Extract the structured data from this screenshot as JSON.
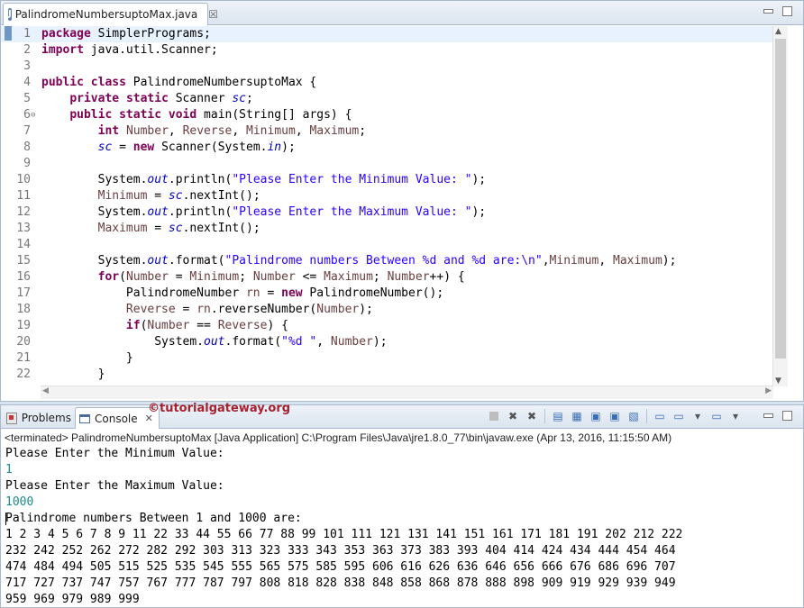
{
  "editor": {
    "tab_label": "PalindromeNumbersuptoMax.java",
    "close_glyph": "☒",
    "lines": [
      {
        "num": "1",
        "tokens": [
          {
            "t": "package",
            "c": "kw"
          },
          {
            "t": " SimplerPrograms;",
            "c": ""
          }
        ]
      },
      {
        "num": "2",
        "tokens": [
          {
            "t": "import",
            "c": "kw"
          },
          {
            "t": " java.util.Scanner;",
            "c": ""
          }
        ]
      },
      {
        "num": "3",
        "tokens": []
      },
      {
        "num": "4",
        "tokens": [
          {
            "t": "public",
            "c": "kw"
          },
          {
            "t": " ",
            "c": ""
          },
          {
            "t": "class",
            "c": "kw"
          },
          {
            "t": " PalindromeNumbersuptoMax {",
            "c": ""
          }
        ]
      },
      {
        "num": "5",
        "tokens": [
          {
            "t": "    ",
            "c": ""
          },
          {
            "t": "private",
            "c": "kw"
          },
          {
            "t": " ",
            "c": ""
          },
          {
            "t": "static",
            "c": "kw"
          },
          {
            "t": " Scanner ",
            "c": ""
          },
          {
            "t": "sc",
            "c": "sfld"
          },
          {
            "t": ";",
            "c": ""
          }
        ]
      },
      {
        "num": "6",
        "fold": true,
        "tokens": [
          {
            "t": "    ",
            "c": ""
          },
          {
            "t": "public",
            "c": "kw"
          },
          {
            "t": " ",
            "c": ""
          },
          {
            "t": "static",
            "c": "kw"
          },
          {
            "t": " ",
            "c": ""
          },
          {
            "t": "void",
            "c": "kw"
          },
          {
            "t": " main(String[] args) {",
            "c": ""
          }
        ]
      },
      {
        "num": "7",
        "tokens": [
          {
            "t": "        ",
            "c": ""
          },
          {
            "t": "int",
            "c": "kw"
          },
          {
            "t": " ",
            "c": ""
          },
          {
            "t": "Number",
            "c": "var"
          },
          {
            "t": ", ",
            "c": ""
          },
          {
            "t": "Reverse",
            "c": "var"
          },
          {
            "t": ", ",
            "c": ""
          },
          {
            "t": "Minimum",
            "c": "var"
          },
          {
            "t": ", ",
            "c": ""
          },
          {
            "t": "Maximum",
            "c": "var"
          },
          {
            "t": ";",
            "c": ""
          }
        ]
      },
      {
        "num": "8",
        "tokens": [
          {
            "t": "        ",
            "c": ""
          },
          {
            "t": "sc",
            "c": "sfld"
          },
          {
            "t": " = ",
            "c": ""
          },
          {
            "t": "new",
            "c": "kw"
          },
          {
            "t": " Scanner(System.",
            "c": ""
          },
          {
            "t": "in",
            "c": "sfld"
          },
          {
            "t": ");",
            "c": ""
          }
        ]
      },
      {
        "num": "9",
        "tokens": []
      },
      {
        "num": "10",
        "tokens": [
          {
            "t": "        System.",
            "c": ""
          },
          {
            "t": "out",
            "c": "sfld"
          },
          {
            "t": ".println(",
            "c": ""
          },
          {
            "t": "\"Please Enter the Minimum Value: \"",
            "c": "str"
          },
          {
            "t": ");",
            "c": ""
          }
        ]
      },
      {
        "num": "11",
        "tokens": [
          {
            "t": "        ",
            "c": ""
          },
          {
            "t": "Minimum",
            "c": "var"
          },
          {
            "t": " = ",
            "c": ""
          },
          {
            "t": "sc",
            "c": "sfld"
          },
          {
            "t": ".nextInt();",
            "c": ""
          }
        ]
      },
      {
        "num": "12",
        "tokens": [
          {
            "t": "        System.",
            "c": ""
          },
          {
            "t": "out",
            "c": "sfld"
          },
          {
            "t": ".println(",
            "c": ""
          },
          {
            "t": "\"Please Enter the Maximum Value: \"",
            "c": "str"
          },
          {
            "t": ");",
            "c": ""
          }
        ]
      },
      {
        "num": "13",
        "tokens": [
          {
            "t": "        ",
            "c": ""
          },
          {
            "t": "Maximum",
            "c": "var"
          },
          {
            "t": " = ",
            "c": ""
          },
          {
            "t": "sc",
            "c": "sfld"
          },
          {
            "t": ".nextInt();",
            "c": ""
          }
        ]
      },
      {
        "num": "14",
        "tokens": []
      },
      {
        "num": "15",
        "tokens": [
          {
            "t": "        System.",
            "c": ""
          },
          {
            "t": "out",
            "c": "sfld"
          },
          {
            "t": ".format(",
            "c": ""
          },
          {
            "t": "\"Palindrome numbers Between %d and %d are:\\n\"",
            "c": "str"
          },
          {
            "t": ",",
            "c": ""
          },
          {
            "t": "Minimum",
            "c": "var"
          },
          {
            "t": ", ",
            "c": ""
          },
          {
            "t": "Maximum",
            "c": "var"
          },
          {
            "t": ");",
            "c": ""
          }
        ]
      },
      {
        "num": "16",
        "tokens": [
          {
            "t": "        ",
            "c": ""
          },
          {
            "t": "for",
            "c": "kw"
          },
          {
            "t": "(",
            "c": ""
          },
          {
            "t": "Number",
            "c": "var"
          },
          {
            "t": " = ",
            "c": ""
          },
          {
            "t": "Minimum",
            "c": "var"
          },
          {
            "t": "; ",
            "c": ""
          },
          {
            "t": "Number",
            "c": "var"
          },
          {
            "t": " <= ",
            "c": ""
          },
          {
            "t": "Maximum",
            "c": "var"
          },
          {
            "t": "; ",
            "c": ""
          },
          {
            "t": "Number",
            "c": "var"
          },
          {
            "t": "++) {",
            "c": ""
          }
        ]
      },
      {
        "num": "17",
        "tokens": [
          {
            "t": "            PalindromeNumber ",
            "c": ""
          },
          {
            "t": "rn",
            "c": "var"
          },
          {
            "t": " = ",
            "c": ""
          },
          {
            "t": "new",
            "c": "kw"
          },
          {
            "t": " PalindromeNumber();",
            "c": ""
          }
        ]
      },
      {
        "num": "18",
        "tokens": [
          {
            "t": "            ",
            "c": ""
          },
          {
            "t": "Reverse",
            "c": "var"
          },
          {
            "t": " = ",
            "c": ""
          },
          {
            "t": "rn",
            "c": "var"
          },
          {
            "t": ".reverseNumber(",
            "c": ""
          },
          {
            "t": "Number",
            "c": "var"
          },
          {
            "t": ");",
            "c": ""
          }
        ]
      },
      {
        "num": "19",
        "tokens": [
          {
            "t": "            ",
            "c": ""
          },
          {
            "t": "if",
            "c": "kw"
          },
          {
            "t": "(",
            "c": ""
          },
          {
            "t": "Number",
            "c": "var"
          },
          {
            "t": " == ",
            "c": ""
          },
          {
            "t": "Reverse",
            "c": "var"
          },
          {
            "t": ") {",
            "c": ""
          }
        ]
      },
      {
        "num": "20",
        "tokens": [
          {
            "t": "                System.",
            "c": ""
          },
          {
            "t": "out",
            "c": "sfld"
          },
          {
            "t": ".format(",
            "c": ""
          },
          {
            "t": "\"%d \"",
            "c": "str"
          },
          {
            "t": ", ",
            "c": ""
          },
          {
            "t": "Number",
            "c": "var"
          },
          {
            "t": ");",
            "c": ""
          }
        ]
      },
      {
        "num": "21",
        "tokens": [
          {
            "t": "            }",
            "c": ""
          }
        ]
      },
      {
        "num": "22",
        "tokens": [
          {
            "t": "        }",
            "c": ""
          }
        ]
      }
    ]
  },
  "console": {
    "tabs": {
      "problems": "Problems",
      "console": "Console"
    },
    "watermark": "©tutorialgateway.org",
    "launch_info": "<terminated> PalindromeNumbersuptoMax [Java Application] C:\\Program Files\\Java\\jre1.8.0_77\\bin\\javaw.exe (Apr 13, 2016, 11:15:50 AM)",
    "output": [
      {
        "text": "Please Enter the Minimum Value: ",
        "type": "out"
      },
      {
        "text": "1",
        "type": "input"
      },
      {
        "text": "Please Enter the Maximum Value: ",
        "type": "out"
      },
      {
        "text": "1000",
        "type": "input"
      },
      {
        "text": "Palindrome numbers Between 1 and 1000 are:",
        "type": "out",
        "caret": true
      },
      {
        "text": "1 2 3 4 5 6 7 8 9 11 22 33 44 55 66 77 88 99 101 111 121 131 141 151 161 171 181 191 202 212 222",
        "type": "out"
      },
      {
        "text": "232 242 252 262 272 282 292 303 313 323 333 343 353 363 373 383 393 404 414 424 434 444 454 464",
        "type": "out"
      },
      {
        "text": "474 484 494 505 515 525 535 545 555 565 575 585 595 606 616 626 636 646 656 666 676 686 696 707",
        "type": "out"
      },
      {
        "text": "717 727 737 747 757 767 777 787 797 808 818 828 838 848 858 868 878 888 898 909 919 929 939 949",
        "type": "out"
      },
      {
        "text": "959 969 979 989 999",
        "type": "out"
      }
    ]
  }
}
